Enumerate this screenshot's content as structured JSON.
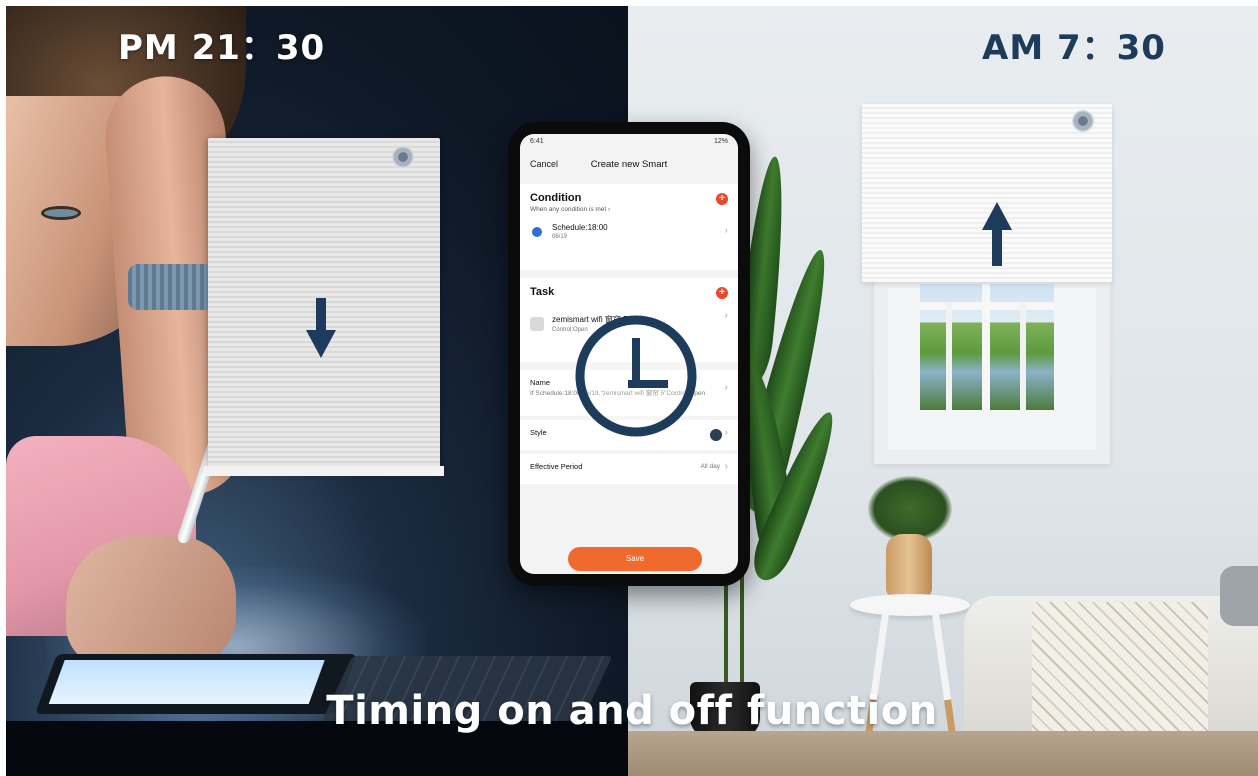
{
  "times": {
    "night": "PM 21：30",
    "morning": "AM 7：30"
  },
  "caption": "Timing on and off function",
  "phone": {
    "status_time": "6:41",
    "status_right": "12%",
    "cancel": "Cancel",
    "title": "Create new Smart",
    "condition": {
      "title": "Condition",
      "subtitle": "When any condition is met ›",
      "item_title": "Schedule:18:00",
      "item_sub": "06/19"
    },
    "task": {
      "title": "Task",
      "item_title": "zemismart wifi 窗帘 5",
      "item_sub": "Control:Open"
    },
    "name": {
      "label": "Name",
      "value": "If Schedule:18:00 06/19,\"zemismart wifi 窗帘 5\"Control:Open"
    },
    "style": {
      "label": "Style"
    },
    "period": {
      "label": "Effective Period",
      "value": "All day"
    },
    "save": "Save"
  },
  "colors": {
    "accent_orange": "#f06a2e",
    "add_red": "#e8492e",
    "navy": "#1d3c5c"
  },
  "icons": [
    "shade-sensor-icon",
    "arrow-down-icon",
    "arrow-up-icon",
    "clock-icon",
    "add-icon",
    "chevron-right-icon"
  ]
}
